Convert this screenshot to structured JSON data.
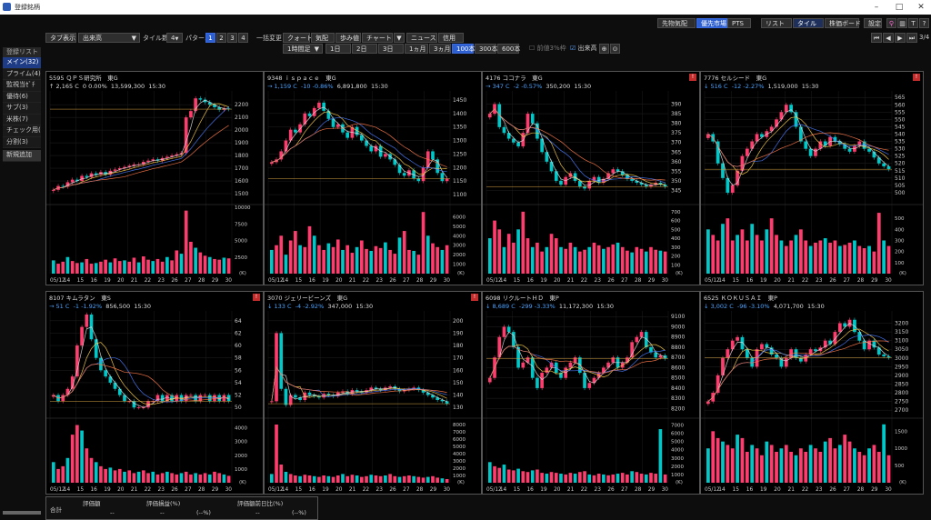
{
  "window": {
    "title": "登録銘柄"
  },
  "topright": [
    "先物気配",
    "PTS",
    "リスト",
    "タイル",
    "株価ボード",
    "設定"
  ],
  "nav": {
    "page": "3/4"
  },
  "toolbar": {
    "tab_label": "タブ表示",
    "tab_value": "出来高",
    "tile_label": "タイル数",
    "tile_value": "4",
    "pattern_label": "パターン",
    "patterns": [
      "1",
      "2",
      "3",
      "4"
    ],
    "bulk_label": "一括変更",
    "buttons": [
      "クォート",
      "気配",
      "歩み値",
      "チャート",
      "ニュース",
      "信用"
    ],
    "interval": "1時間足",
    "periods": [
      "1日",
      "2日",
      "3日",
      "1ヵ月",
      "3ヵ月",
      "100本",
      "300本",
      "600本"
    ],
    "check1": "前値3%枠",
    "check2": "出来高"
  },
  "sidebar": {
    "header": "登録リスト",
    "items": [
      "メイン(32)",
      "プライム(4)",
      "監視当ｾﾞﾁ",
      "優待(6)",
      "サブ(3)",
      "米株(7)",
      "チェック用(",
      "分割(3)",
      "新規追加"
    ]
  },
  "colors": {
    "up": "#ff3c6e",
    "down": "#00c8c8",
    "ma1": "#e0e0e0",
    "ma2": "#ffd24a",
    "ma3": "#4a7cff",
    "ma4": "#ff7a4a"
  },
  "panels": [
    {
      "header": "5595 ＱＰＳ研究所　東G",
      "arrow": "↑",
      "price": "2,165 C",
      "change": "0",
      "pct": "0.00%",
      "sign": "flat",
      "volume": "13,599,300",
      "time": "15:30",
      "alert": false,
      "prices": [
        1530,
        1560,
        1555,
        1590,
        1610,
        1600,
        1640,
        1630,
        1660,
        1650,
        1670,
        1650,
        1680,
        1690,
        1700,
        1710,
        1720,
        1730,
        1730,
        1750,
        1760,
        1770,
        1760,
        1780,
        1790,
        1800,
        1810,
        1820,
        2100,
        2150,
        2250,
        2240,
        2220,
        2200,
        2180,
        2160,
        2170,
        2165
      ],
      "volumes": [
        2000,
        1500,
        1800,
        2500,
        1900,
        1600,
        1700,
        2200,
        1500,
        1600,
        1800,
        2100,
        1700,
        2300,
        1900,
        2000,
        1800,
        2400,
        1700,
        2600,
        2100,
        1900,
        2200,
        1800,
        2500,
        2000,
        3500,
        3000,
        9500,
        4800,
        3900,
        3200,
        2700,
        2500,
        2200,
        2100,
        2400,
        2300
      ],
      "y": [
        1450,
        2280
      ],
      "yticks": [
        "2200",
        "2100",
        "2000",
        "1900",
        "1800",
        "1700",
        "1600",
        "1500"
      ],
      "vticks": [
        "10000",
        "7500",
        "5000",
        "2500"
      ],
      "vmax": 10000
    },
    {
      "header": "9348 ｉｓｐａｃｅ　東G",
      "arrow": "→",
      "price": "1,159 C",
      "change": "-10",
      "pct": "-0.86%",
      "sign": "neg",
      "volume": "6,891,800",
      "time": "15:30",
      "alert": false,
      "prices": [
        1220,
        1230,
        1260,
        1300,
        1340,
        1330,
        1360,
        1400,
        1390,
        1420,
        1440,
        1410,
        1380,
        1350,
        1360,
        1330,
        1310,
        1350,
        1320,
        1300,
        1280,
        1260,
        1280,
        1240,
        1250,
        1230,
        1210,
        1180,
        1170,
        1190,
        1160,
        1150,
        1200,
        1260,
        1230,
        1180,
        1150,
        1159
      ],
      "volumes": [
        2500,
        3000,
        4000,
        2000,
        3500,
        4500,
        3000,
        2800,
        5000,
        4000,
        3000,
        2500,
        3200,
        2800,
        3600,
        2500,
        3000,
        2200,
        2800,
        3500,
        2600,
        2400,
        2900,
        2700,
        3300,
        2500,
        2100,
        3800,
        4500,
        2500,
        2400,
        2000,
        6500,
        4000,
        3200,
        2800,
        2500,
        3000
      ],
      "y": [
        1080,
        1470
      ],
      "yticks": [
        "1450",
        "1400",
        "1350",
        "1300",
        "1250",
        "1200",
        "1150",
        "1100"
      ],
      "vticks": [
        "6000",
        "5000",
        "4000",
        "3000",
        "2000",
        "1000"
      ],
      "vmax": 7000
    },
    {
      "header": "4176 ココナラ　東G",
      "arrow": "→",
      "price": "347 C",
      "change": "-2",
      "pct": "-0.57%",
      "sign": "neg",
      "volume": "350,200",
      "time": "15:30",
      "alert": true,
      "prices": [
        385,
        390,
        378,
        375,
        372,
        370,
        368,
        375,
        385,
        380,
        372,
        365,
        360,
        355,
        350,
        348,
        352,
        354,
        350,
        347,
        346,
        350,
        352,
        349,
        351,
        354,
        356,
        355,
        353,
        351,
        350,
        349,
        348,
        347,
        348,
        349,
        348,
        347
      ],
      "volumes": [
        400,
        600,
        500,
        300,
        450,
        350,
        500,
        700,
        400,
        300,
        350,
        250,
        300,
        450,
        400,
        300,
        280,
        350,
        300,
        250,
        270,
        300,
        350,
        320,
        280,
        300,
        330,
        350,
        300,
        260,
        240,
        300,
        280,
        250,
        300,
        270,
        260,
        250
      ],
      "y": [
        340,
        395
      ],
      "yticks": [
        "390",
        "385",
        "380",
        "375",
        "370",
        "365",
        "360",
        "355",
        "350",
        "345"
      ],
      "vticks": [
        "700",
        "600",
        "500",
        "400",
        "300",
        "200",
        "100"
      ],
      "vmax": 750
    },
    {
      "header": "7776 セルシード　東G",
      "arrow": "↓",
      "price": "516 C",
      "change": "-12",
      "pct": "-2.27%",
      "sign": "neg",
      "volume": "1,519,000",
      "time": "15:30",
      "alert": true,
      "prices": [
        540,
        535,
        520,
        510,
        500,
        505,
        515,
        525,
        530,
        535,
        540,
        538,
        542,
        545,
        550,
        555,
        560,
        555,
        545,
        535,
        530,
        525,
        530,
        535,
        532,
        538,
        535,
        533,
        530,
        528,
        532,
        535,
        530,
        528,
        524,
        520,
        518,
        516
      ],
      "volumes": [
        400,
        350,
        300,
        450,
        500,
        300,
        350,
        400,
        300,
        450,
        350,
        300,
        400,
        500,
        350,
        300,
        250,
        300,
        350,
        400,
        300,
        250,
        280,
        300,
        320,
        280,
        300,
        250,
        260,
        280,
        300,
        250,
        230,
        250,
        200,
        550,
        300,
        250
      ],
      "y": [
        495,
        567
      ],
      "yticks": [
        "565",
        "560",
        "555",
        "550",
        "545",
        "540",
        "535",
        "530",
        "525",
        "520",
        "515",
        "510",
        "505",
        "500"
      ],
      "vticks": [
        "500",
        "400",
        "300",
        "200",
        "100"
      ],
      "vmax": 600
    },
    {
      "header": "8107 キムラタン　東S",
      "arrow": "→",
      "price": "51 C",
      "change": "-1",
      "pct": "-1.92%",
      "sign": "neg",
      "volume": "856,500",
      "time": "15:30",
      "alert": true,
      "prices": [
        52,
        51,
        52,
        53,
        55,
        60,
        63,
        65,
        61,
        58,
        56,
        55,
        54,
        53,
        52,
        51,
        51,
        50,
        50,
        50,
        51,
        51,
        52,
        51,
        52,
        51,
        52,
        51,
        52,
        52,
        51,
        52,
        52,
        51,
        52,
        51,
        52,
        51
      ],
      "volumes": [
        1500,
        1000,
        1200,
        1800,
        3500,
        4200,
        3800,
        2500,
        1800,
        1500,
        1200,
        1000,
        1100,
        900,
        1000,
        800,
        900,
        700,
        800,
        900,
        700,
        800,
        600,
        700,
        800,
        700,
        600,
        700,
        800,
        600,
        700,
        600,
        700,
        600,
        800,
        700,
        600,
        500
      ],
      "y": [
        49,
        65
      ],
      "yticks": [
        "64",
        "62",
        "60",
        "58",
        "56",
        "54",
        "52",
        "50"
      ],
      "vticks": [
        "4000",
        "3000",
        "2000",
        "1000"
      ],
      "vmax": 4500
    },
    {
      "header": "3070 ジェリービーンズ　東G",
      "arrow": "↓",
      "price": "133 C",
      "change": "-4",
      "pct": "-2.92%",
      "sign": "neg",
      "volume": "347,000",
      "time": "15:30",
      "alert": true,
      "prices": [
        135,
        190,
        145,
        132,
        140,
        138,
        136,
        142,
        140,
        139,
        138,
        141,
        140,
        139,
        142,
        143,
        141,
        144,
        143,
        142,
        144,
        146,
        145,
        144,
        146,
        147,
        145,
        143,
        144,
        145,
        146,
        144,
        142,
        140,
        138,
        136,
        135,
        133
      ],
      "volumes": [
        1200,
        8000,
        2500,
        1500,
        1200,
        1000,
        900,
        1100,
        1000,
        900,
        800,
        1000,
        900,
        800,
        1000,
        1200,
        900,
        1100,
        1000,
        800,
        900,
        1100,
        1000,
        900,
        1000,
        1200,
        900,
        800,
        900,
        1000,
        900,
        800,
        700,
        800,
        900,
        700,
        600,
        500
      ],
      "y": [
        125,
        205
      ],
      "yticks": [
        "200",
        "190",
        "180",
        "170",
        "160",
        "150",
        "140",
        "130"
      ],
      "vticks": [
        "8000",
        "7000",
        "6000",
        "5000",
        "4000",
        "3000",
        "2000",
        "1000"
      ],
      "vmax": 8500
    },
    {
      "header": "6098 リクルートＨＤ　東P",
      "arrow": "↓",
      "price": "8,689 C",
      "change": "-299",
      "pct": "-3.33%",
      "sign": "neg",
      "volume": "11,172,300",
      "time": "15:30",
      "alert": false,
      "prices": [
        8500,
        8700,
        8900,
        9000,
        8950,
        8800,
        8600,
        8650,
        8700,
        8500,
        8400,
        8550,
        8600,
        8650,
        8550,
        8500,
        8600,
        8650,
        8700,
        8550,
        8400,
        8450,
        8500,
        8550,
        8600,
        8650,
        8700,
        8600,
        8650,
        8700,
        8850,
        8900,
        8950,
        8800,
        8750,
        8700,
        8720,
        8689
      ],
      "volumes": [
        2500,
        2000,
        1800,
        2200,
        1600,
        1500,
        1700,
        1400,
        1300,
        1500,
        1600,
        1200,
        1100,
        1300,
        1200,
        1100,
        1000,
        1200,
        1100,
        1300,
        1400,
        1000,
        900,
        1100,
        1000,
        900,
        1000,
        1100,
        1200,
        1000,
        1400,
        1300,
        1100,
        1000,
        1200,
        1100,
        6500,
        1000
      ],
      "y": [
        8150,
        9120
      ],
      "yticks": [
        "9100",
        "9000",
        "8900",
        "8800",
        "8700",
        "8600",
        "8500",
        "8400",
        "8300",
        "8200"
      ],
      "vticks": [
        "7000",
        "6000",
        "5000",
        "4000",
        "3000",
        "2000",
        "1000"
      ],
      "vmax": 7500
    },
    {
      "header": "6525 ＫＯＫＵＳＡＩ　東P",
      "arrow": "↓",
      "price": "3,002 C",
      "change": "-96",
      "pct": "-3.10%",
      "sign": "neg",
      "volume": "4,071,700",
      "time": "15:30",
      "alert": false,
      "prices": [
        2750,
        2800,
        2900,
        3000,
        3050,
        3100,
        3120,
        3050,
        3000,
        2950,
        3050,
        3080,
        3060,
        3020,
        3000,
        2950,
        3000,
        3050,
        3000,
        2980,
        3020,
        3050,
        3040,
        3060,
        3100,
        3080,
        3150,
        3200,
        3180,
        3220,
        3150,
        3100,
        3050,
        3100,
        3060,
        3020,
        3010,
        3002
      ],
      "volumes": [
        1000,
        1500,
        1300,
        1200,
        1100,
        1000,
        1400,
        1300,
        900,
        1100,
        1000,
        800,
        1200,
        1100,
        900,
        1000,
        1100,
        900,
        800,
        1000,
        900,
        1100,
        1000,
        900,
        1200,
        1300,
        1000,
        1100,
        1400,
        1200,
        1000,
        900,
        800,
        1000,
        1100,
        900,
        1700,
        800
      ],
      "y": [
        2680,
        3250
      ],
      "yticks": [
        "3200",
        "3150",
        "3100",
        "3050",
        "3000",
        "2950",
        "2900",
        "2850",
        "2800",
        "2750",
        "2700"
      ],
      "vticks": [
        "1500",
        "1000",
        "500"
      ],
      "vmax": 1800
    }
  ],
  "xlabels": [
    "05/12",
    "14",
    "15",
    "16",
    "19",
    "20",
    "21",
    "22",
    "23",
    "26",
    "27",
    "28",
    "29",
    "30"
  ],
  "xlabel_unit": "(K)",
  "status": {
    "label": "合計",
    "cols": [
      "評価額",
      "評価損益(%)",
      "評価額前日比(%)"
    ],
    "vals": [
      "--",
      "--",
      "(--%)",
      "--",
      "(--%)"
    ]
  }
}
